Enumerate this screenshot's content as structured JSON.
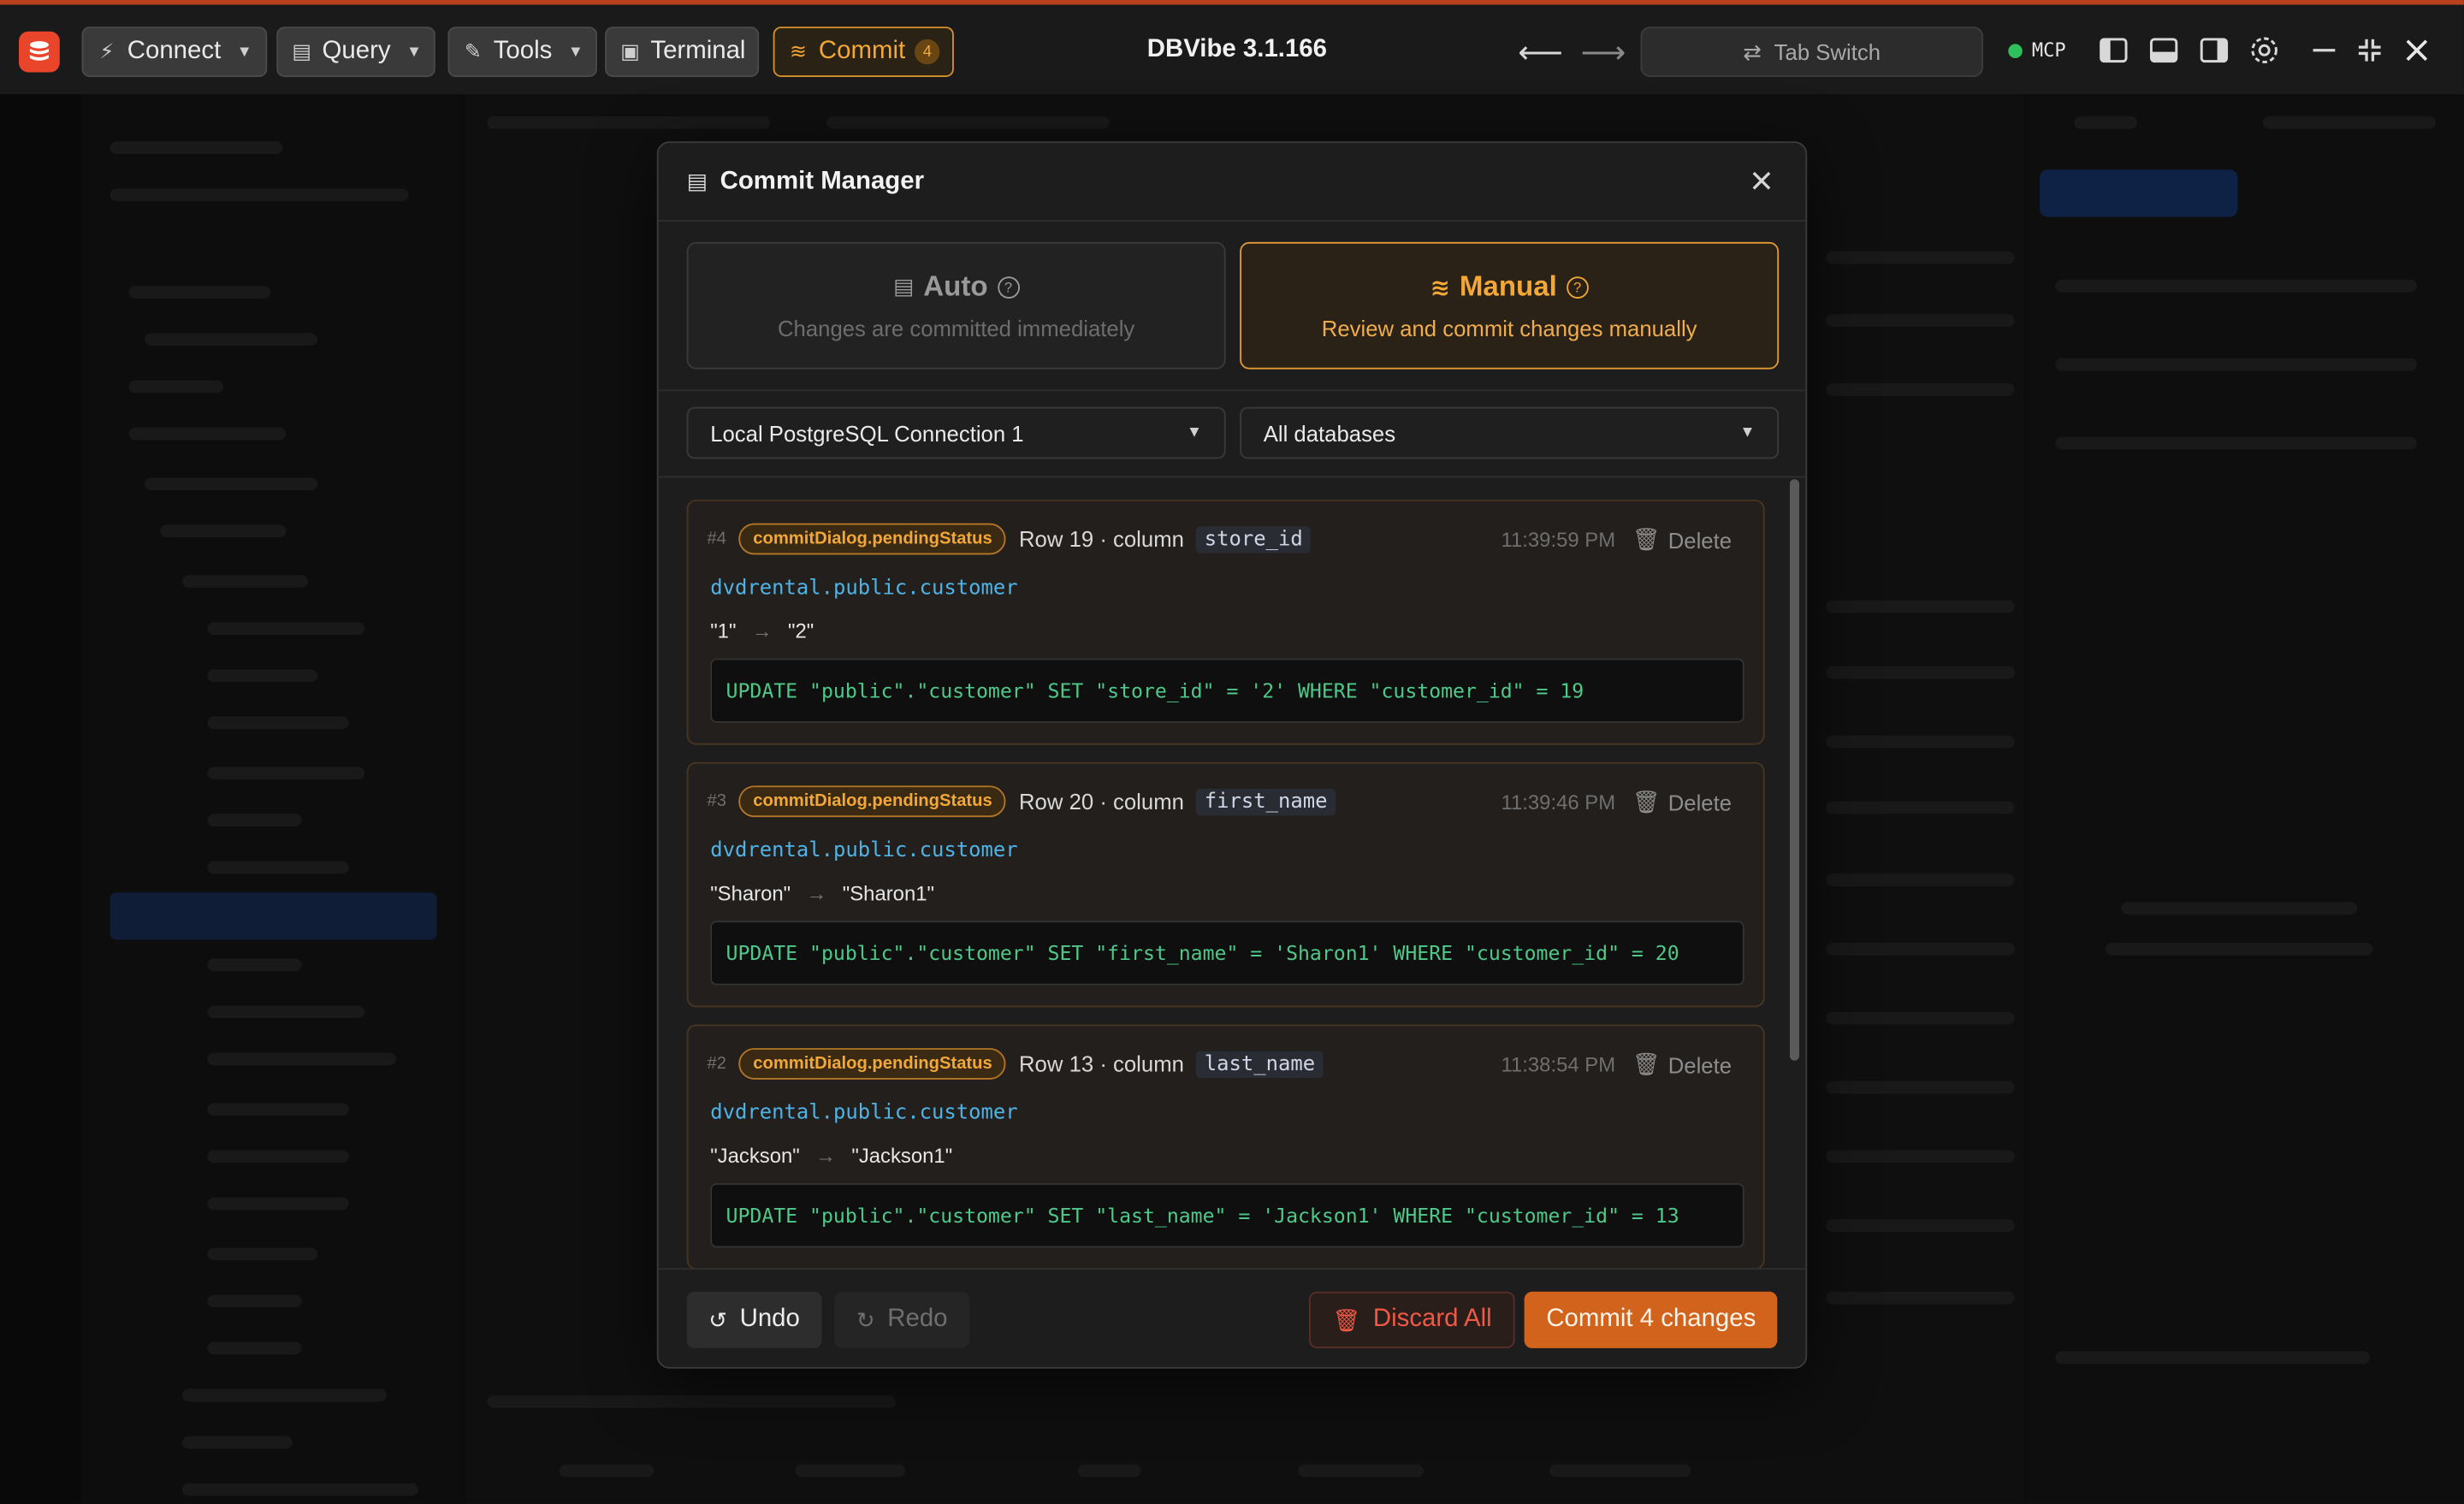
{
  "titlebar": {
    "app_title": "DBVibe 3.1.166",
    "connect_label": "Connect",
    "query_label": "Query",
    "tools_label": "Tools",
    "terminal_label": "Terminal",
    "commit_label": "Commit",
    "commit_count": "4",
    "tab_switch_label": "Tab Switch",
    "mcp_label": "MCP",
    "accent_color": "#e9452a",
    "commit_color": "#f3a737"
  },
  "modal": {
    "title": "Commit Manager",
    "modes": {
      "auto": {
        "title": "Auto",
        "description": "Changes are committed immediately"
      },
      "manual": {
        "title": "Manual",
        "description": "Review and commit changes manually",
        "selected": true
      }
    },
    "connection_select": "Local PostgreSQL Connection 1",
    "database_select": "All databases",
    "changes": [
      {
        "num": "#4",
        "status": "commitDialog.pendingStatus",
        "row_text": "Row 19 · column",
        "column": "store_id",
        "time": "11:39:59 PM",
        "delete_label": "Delete",
        "table": "dvdrental.public.customer",
        "old": "\"1\"",
        "new": "\"2\"",
        "sql": "UPDATE \"public\".\"customer\" SET \"store_id\" = '2' WHERE \"customer_id\" = 19"
      },
      {
        "num": "#3",
        "status": "commitDialog.pendingStatus",
        "row_text": "Row 20 · column",
        "column": "first_name",
        "time": "11:39:46 PM",
        "delete_label": "Delete",
        "table": "dvdrental.public.customer",
        "old": "\"Sharon\"",
        "new": "\"Sharon1\"",
        "sql": "UPDATE \"public\".\"customer\" SET \"first_name\" = 'Sharon1' WHERE \"customer_id\" = 20"
      },
      {
        "num": "#2",
        "status": "commitDialog.pendingStatus",
        "row_text": "Row 13 · column",
        "column": "last_name",
        "time": "11:38:54 PM",
        "delete_label": "Delete",
        "table": "dvdrental.public.customer",
        "old": "\"Jackson\"",
        "new": "\"Jackson1\"",
        "sql": "UPDATE \"public\".\"customer\" SET \"last_name\" = 'Jackson1' WHERE \"customer_id\" = 13"
      }
    ],
    "footer": {
      "undo_label": "Undo",
      "redo_label": "Redo",
      "discard_label": "Discard All",
      "commit_label": "Commit 4 changes"
    }
  }
}
